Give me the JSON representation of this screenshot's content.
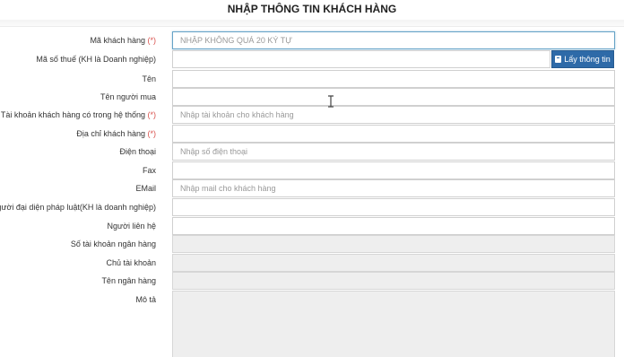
{
  "form": {
    "title": "NHẬP THÔNG TIN KHÁCH HÀNG",
    "lookup_button_label": "Lấy thông tin",
    "fields": [
      {
        "label": "Mã khách hàng",
        "required": "(*)",
        "placeholder": "NHẬP KHÔNG QUÁ 20 KÝ TỰ",
        "value": ""
      },
      {
        "label": "Mã số thuế (KH là Doanh nghiệp)",
        "required": "",
        "placeholder": "",
        "value": ""
      },
      {
        "label": "Tên",
        "required": "",
        "placeholder": "",
        "value": ""
      },
      {
        "label": "Tên người mua",
        "required": "",
        "placeholder": "",
        "value": ""
      },
      {
        "label": "Tài khoản khách hàng có trong hệ thống",
        "required": "(*)",
        "placeholder": "Nhập tài khoản cho khách hàng",
        "value": ""
      },
      {
        "label": "Địa chỉ khách hàng",
        "required": "(*)",
        "placeholder": "",
        "value": ""
      },
      {
        "label": "Điện thoại",
        "required": "",
        "placeholder": "Nhập số điện thoại",
        "value": ""
      },
      {
        "label": "Fax",
        "required": "",
        "placeholder": "",
        "value": ""
      },
      {
        "label": "EMail",
        "required": "",
        "placeholder": "Nhập mail cho khách hàng",
        "value": ""
      },
      {
        "label": "Người đại diện pháp luật(KH là doanh nghiệp)",
        "required": "",
        "placeholder": "",
        "value": ""
      },
      {
        "label": "Người liên hệ",
        "required": "",
        "placeholder": "",
        "value": ""
      },
      {
        "label": "Số tài khoản ngân hàng",
        "required": "",
        "placeholder": "",
        "value": ""
      },
      {
        "label": "Chủ tài khoản",
        "required": "",
        "placeholder": "",
        "value": ""
      },
      {
        "label": "Tên ngân hàng",
        "required": "",
        "placeholder": "",
        "value": ""
      },
      {
        "label": "Mô tả",
        "required": "",
        "placeholder": "",
        "value": ""
      }
    ]
  },
  "colors": {
    "primary_button": "#2e6aa8",
    "required_marker": "#d9534f",
    "focus_border": "#66a3c7",
    "disabled_background": "#eeeeee"
  }
}
